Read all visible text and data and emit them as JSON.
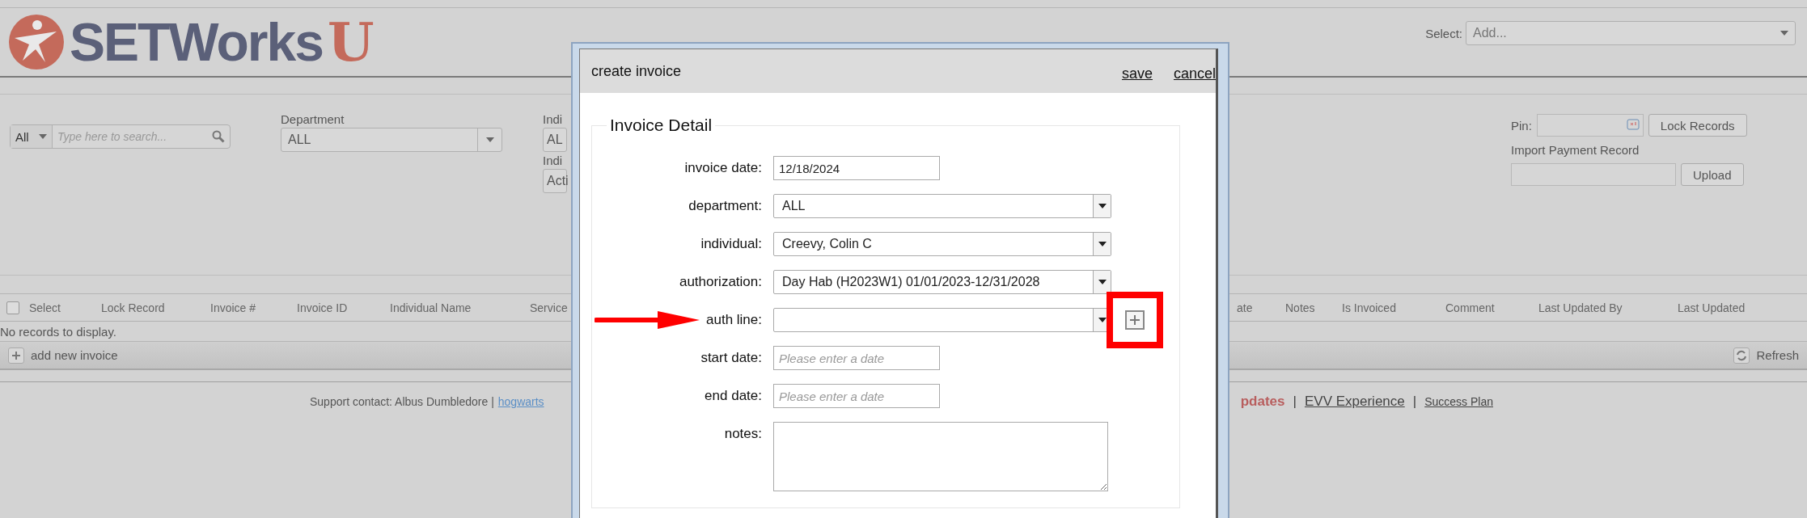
{
  "header": {
    "logo": {
      "text": "SETWorks",
      "badge": "U"
    },
    "select": {
      "label": "Select:",
      "placeholder": "Add..."
    }
  },
  "filters": {
    "scope": {
      "value": "All"
    },
    "search": {
      "placeholder": "Type here to search..."
    },
    "department": {
      "label": "Department",
      "value": "ALL"
    },
    "column_3": [
      {
        "label": "Indi",
        "value": "AL"
      },
      {
        "label": "Indi",
        "value": "Acti"
      }
    ],
    "pin": {
      "label": "Pin:",
      "button": "Lock Records"
    },
    "import": {
      "label": "Import Payment Record",
      "button": "Upload"
    }
  },
  "table": {
    "select_all": {
      "label": "Select",
      "checked": false
    },
    "columns": [
      "Lock Record",
      "Invoice #",
      "Invoice ID",
      "Individual Name",
      "Service"
    ],
    "columns_right": [
      "ate",
      "Notes",
      "Is Invoiced",
      "Comment",
      "Last Updated By",
      "Last Updated"
    ],
    "empty_message": "No records to display.",
    "add_label": "add new invoice",
    "refresh_label": "Refresh"
  },
  "footer": {
    "support": "Support contact: Albus Dumbledore |",
    "email": "hogwarts",
    "links": [
      {
        "label": "pdates",
        "kind": "alert"
      },
      {
        "label": "|",
        "kind": "separator"
      },
      {
        "label": "EVV Experience",
        "kind": "link"
      },
      {
        "label": "|",
        "kind": "separator"
      },
      {
        "label": "Success Plan",
        "kind": "small"
      }
    ]
  },
  "dialog": {
    "title": "create invoice",
    "actions": [
      "save",
      "cancel"
    ],
    "section": "Invoice Detail",
    "fields": [
      {
        "label": "invoice date:",
        "kind": "text",
        "value": "12/18/2024"
      },
      {
        "label": "department:",
        "kind": "select",
        "value": "ALL"
      },
      {
        "label": "individual:",
        "kind": "select",
        "value": "Creevy, Colin C"
      },
      {
        "label": "authorization:",
        "kind": "select",
        "value": "Day Hab (H2023W1) 01/01/2023-12/31/2028"
      },
      {
        "label": "auth line:",
        "kind": "select",
        "annotated": true
      },
      {
        "label": "start date:",
        "kind": "text",
        "placeholder": "Please enter a date"
      },
      {
        "label": "end date:",
        "kind": "text",
        "placeholder": "Please enter a date"
      },
      {
        "label": "notes:",
        "kind": "textarea"
      }
    ]
  }
}
